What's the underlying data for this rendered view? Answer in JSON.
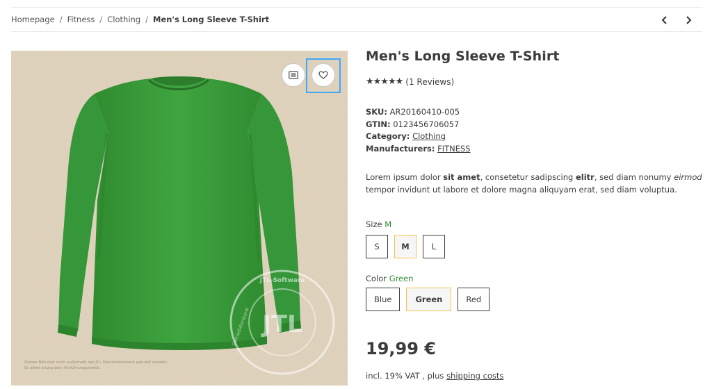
{
  "breadcrumb": {
    "items": [
      "Homepage",
      "Fitness",
      "Clothing"
    ],
    "separator": "/",
    "current": "Men's Long Sleeve T-Shirt"
  },
  "gallery": {
    "shirt_color": "#3d9f3d",
    "background_color": "#e4d7c1",
    "watermark_text": "JTL-Software",
    "watermark_side": "Demodatenbank",
    "fine_print": [
      "Dieses Bild darf nicht außerhalb der JTL-Demodatenbank genutzt werden.",
      "Es dient einzig dem Vorführungszweck."
    ]
  },
  "product": {
    "title": "Men's Long Sleeve T-Shirt",
    "stars": "★★★★★",
    "reviews": "(1 Reviews)",
    "sku_label": "SKU:",
    "sku": "AR20160410-005",
    "gtin_label": "GTIN:",
    "gtin": "0123456706057",
    "category_label": "Category:",
    "category": "Clothing",
    "manufacturer_label": "Manufacturers:",
    "manufacturer": "FITNESS",
    "description": {
      "p1": "Lorem ipsum dolor ",
      "b1": "sit amet",
      "p2": ", consetetur sadipscing ",
      "b2": "elitr",
      "p3": ", sed diam nonumy ",
      "i1": "eirmod",
      "p4": " tempor invidunt ut labore et dolore magna aliquyam erat, sed diam voluptua."
    },
    "size_label": "Size",
    "size_selected": "M",
    "sizes": [
      "S",
      "M",
      "L"
    ],
    "color_label": "Color",
    "color_selected": "Green",
    "colors": [
      "Blue",
      "Green",
      "Red"
    ],
    "price": "19,99 €",
    "vat_text": "incl. 19% VAT , plus ",
    "shipping_link": "shipping costs"
  },
  "colors": {
    "accent_selected": "#f3c54a",
    "variant_value": "#2e8b2e",
    "highlight": "#3fa9f5"
  }
}
